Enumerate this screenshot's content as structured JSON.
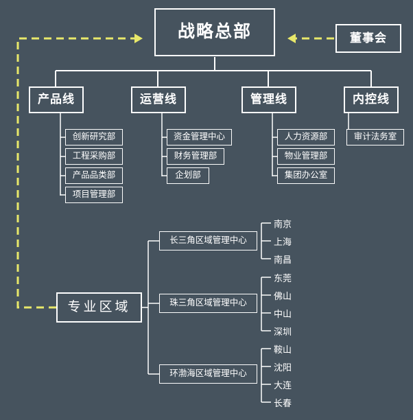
{
  "diagram": {
    "type": "org-chart",
    "background_color": "#46535e",
    "line_color": "#ffffff",
    "dashed_line_color": "#e8e86a",
    "text_color": "#ffffff",
    "headquarters": {
      "label": "战略总部"
    },
    "board": {
      "label": "董事会"
    },
    "lines": [
      {
        "label": "产品线",
        "departments": [
          {
            "label": "创新研究部"
          },
          {
            "label": "工程采购部"
          },
          {
            "label": "产品品类部"
          },
          {
            "label": "项目管理部"
          }
        ]
      },
      {
        "label": "运营线",
        "departments": [
          {
            "label": "资金管理中心"
          },
          {
            "label": "财务管理部"
          },
          {
            "label": "企划部"
          }
        ]
      },
      {
        "label": "管理线",
        "departments": [
          {
            "label": "人力资源部"
          },
          {
            "label": "物业管理部"
          },
          {
            "label": "集团办公室"
          }
        ]
      },
      {
        "label": "内控线",
        "departments": [
          {
            "label": "审计法务室"
          }
        ]
      }
    ],
    "region": {
      "label": "专业区域",
      "centers": [
        {
          "label": "长三角区域管理中心",
          "cities": [
            "南京",
            "上海",
            "南昌"
          ]
        },
        {
          "label": "珠三角区域管理中心",
          "cities": [
            "东莞",
            "佛山",
            "中山",
            "深圳"
          ]
        },
        {
          "label": "环渤海区域管理中心",
          "cities": [
            "鞍山",
            "沈阳",
            "大连",
            "长春"
          ]
        }
      ]
    }
  }
}
